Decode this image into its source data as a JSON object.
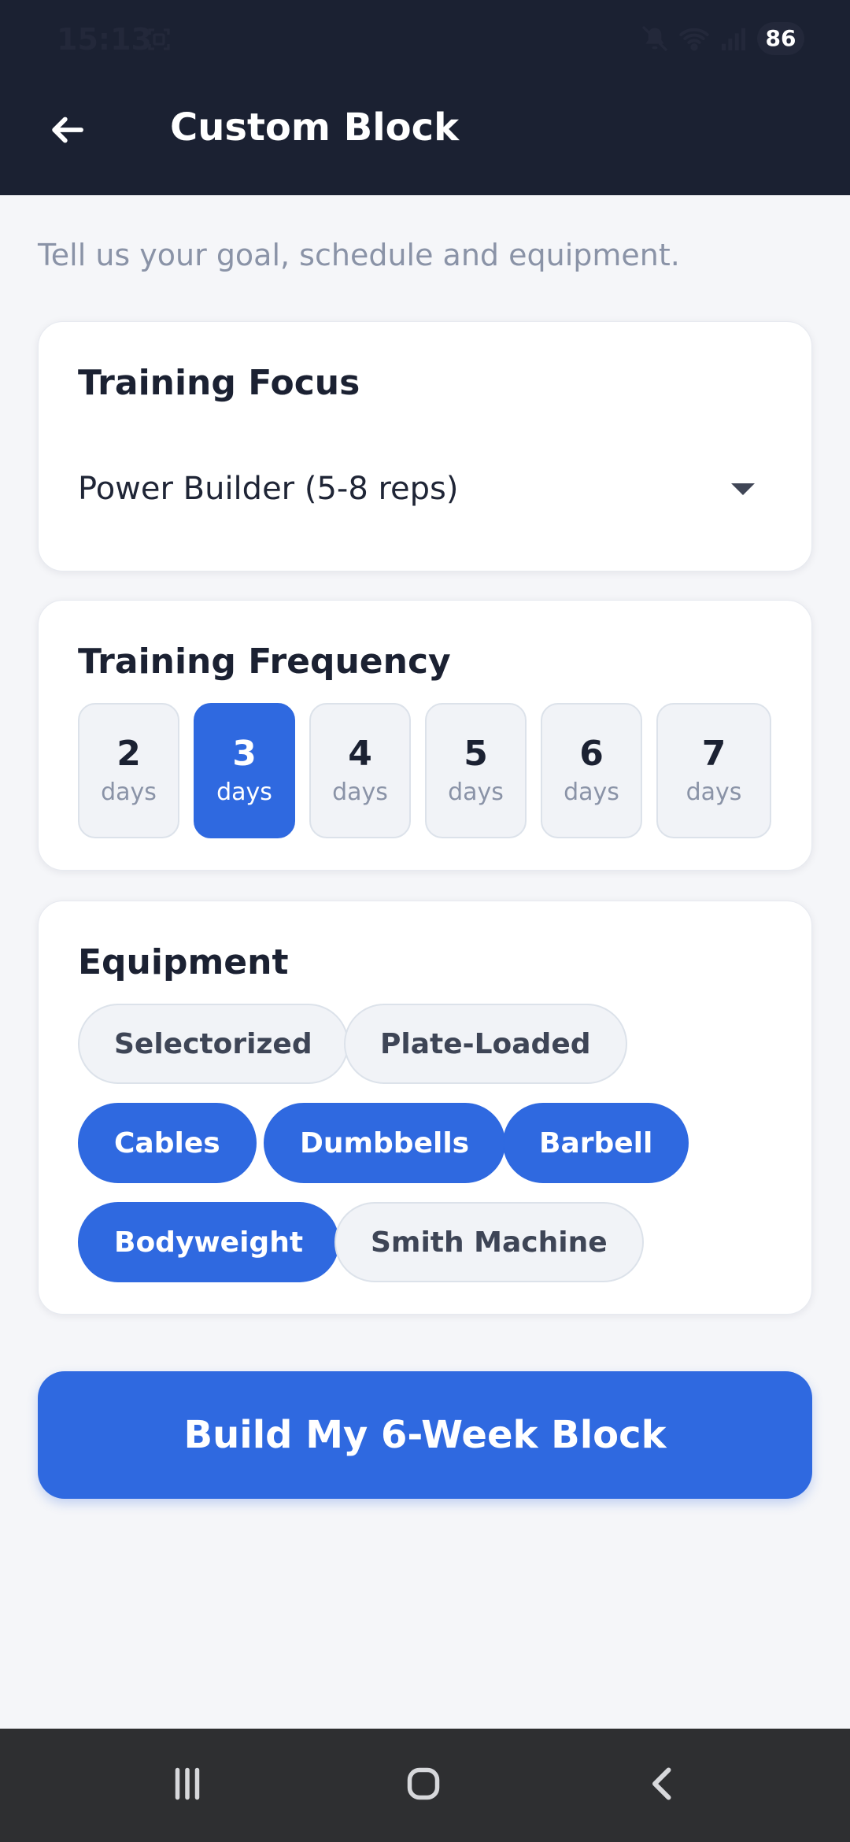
{
  "status": {
    "time": "15:13",
    "battery": "86",
    "icons": [
      "screenshot-icon",
      "mute-icon",
      "wifi-icon",
      "signal-icon",
      "battery-icon"
    ]
  },
  "header": {
    "title": "Custom Block",
    "back_icon": "arrow-left-icon"
  },
  "subtitle": "Tell us your goal, schedule and equipment.",
  "training_focus": {
    "title": "Training Focus",
    "selected": "Power Builder (5-8 reps)",
    "icon": "dropdown-arrow-icon"
  },
  "frequency": {
    "title": "Training Frequency",
    "options": [
      {
        "number": "2",
        "label": "days",
        "selected": false
      },
      {
        "number": "3",
        "label": "days",
        "selected": true
      },
      {
        "number": "4",
        "label": "days",
        "selected": false
      },
      {
        "number": "5",
        "label": "days",
        "selected": false
      },
      {
        "number": "6",
        "label": "days",
        "selected": false
      },
      {
        "number": "7",
        "label": "days",
        "selected": false
      }
    ]
  },
  "equipment": {
    "title": "Equipment",
    "items": [
      {
        "label": "Selectorized",
        "selected": false
      },
      {
        "label": "Plate-Loaded",
        "selected": false
      },
      {
        "label": "Cables",
        "selected": true
      },
      {
        "label": "Dumbbells",
        "selected": true
      },
      {
        "label": "Barbell",
        "selected": true
      },
      {
        "label": "Bodyweight",
        "selected": true
      },
      {
        "label": "Smith Machine",
        "selected": false
      }
    ]
  },
  "cta": {
    "label": "Build My 6-Week Block"
  },
  "nav": {
    "icons": [
      "recent-apps-icon",
      "home-icon",
      "back-icon"
    ]
  },
  "colors": {
    "header_bg": "#1B2132",
    "accent": "#2F69E0",
    "page_bg": "#F5F6F9",
    "chip_bg": "#F1F3F7",
    "text_dark": "#1B2132",
    "text_muted": "#8A93A7"
  }
}
